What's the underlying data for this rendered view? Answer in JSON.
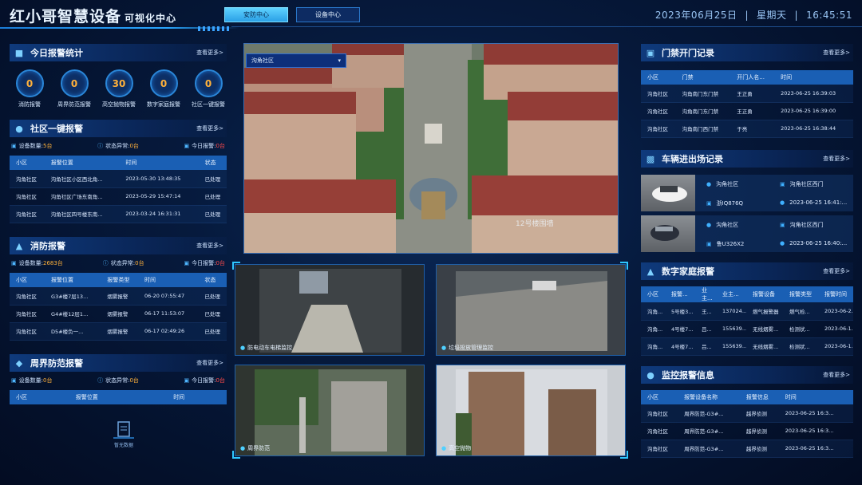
{
  "header": {
    "title": "红小哥智慧设备",
    "subtitle": "可视化中心",
    "tabs": [
      "安防中心",
      "设备中心"
    ],
    "date": "2023年06月25日",
    "weekday": "星期天",
    "time": "16:45:51"
  },
  "more_label": "查看更多>",
  "alarm_stats": {
    "title": "今日报警统计",
    "items": [
      {
        "label": "消防报警",
        "value": "0"
      },
      {
        "label": "周界防范报警",
        "value": "0"
      },
      {
        "label": "高空抛物报警",
        "value": "30"
      },
      {
        "label": "数字家庭报警",
        "value": "0"
      },
      {
        "label": "社区一键报警",
        "value": "0"
      }
    ]
  },
  "community_alarm": {
    "title": "社区一键报警",
    "device_count_label": "设备数量:",
    "device_count": "5台",
    "status_label": "状态异常:",
    "status_abnormal": "0台",
    "today_label": "今日报警:",
    "today_alarm": "0台",
    "columns": [
      "小区",
      "报警位置",
      "时间",
      "状态"
    ],
    "rows": [
      [
        "沟角社区",
        "沟角社区小区西北角...",
        "2023-05-30 13:48:35",
        "已处理"
      ],
      [
        "沟角社区",
        "沟角社区广场东南角...",
        "2023-05-29 15:47:14",
        "已处理"
      ],
      [
        "沟角社区",
        "沟角社区四号楼东南...",
        "2023-03-24 16:31:31",
        "已处理"
      ]
    ]
  },
  "fire_alarm": {
    "title": "消防报警",
    "device_count_label": "设备数量:",
    "device_count": "2683台",
    "status_label": "状态异常:",
    "status_abnormal": "0台",
    "today_label": "今日报警:",
    "today_alarm": "0台",
    "columns": [
      "小区",
      "报警位置",
      "报警类型",
      "时间",
      "状态"
    ],
    "rows": [
      [
        "沟角社区",
        "G3#楼7层13...",
        "烟雾报警",
        "06-20 07:55:47",
        "已处理"
      ],
      [
        "沟角社区",
        "G4#楼12层1...",
        "烟雾报警",
        "06-17 11:53:07",
        "已处理"
      ],
      [
        "沟角社区",
        "D5#楼负一...",
        "烟雾报警",
        "06-17 02:49:26",
        "已处理"
      ]
    ]
  },
  "perimeter_alarm": {
    "title": "周界防范报警",
    "device_count_label": "设备数量:",
    "device_count": "0台",
    "status_label": "状态异常:",
    "status_abnormal": "0台",
    "today_label": "今日报警:",
    "today_alarm": "0台",
    "columns": [
      "小区",
      "报警位置",
      "时间"
    ],
    "no_data": "暂无数据"
  },
  "main_video": {
    "select_value": "沟角社区",
    "overlay_text": "12号楼围墙"
  },
  "cameras": [
    {
      "label": "防电动车电梯监控"
    },
    {
      "label": "垃圾投放管理监控"
    },
    {
      "label": "周界防范"
    },
    {
      "label": "高空抛物"
    }
  ],
  "door_records": {
    "title": "门禁开门记录",
    "columns": [
      "小区",
      "门禁",
      "开门人名...",
      "时间"
    ],
    "rows": [
      [
        "沟角社区",
        "沟角南门东门禁",
        "王正勇",
        "2023-06-25 16:39:03"
      ],
      [
        "沟角社区",
        "沟角南门东门禁",
        "王正勇",
        "2023-06-25 16:39:00"
      ],
      [
        "沟角社区",
        "沟角南门西门禁",
        "于亮",
        "2023-06-25 16:38:44"
      ]
    ]
  },
  "vehicle_records": {
    "title": "车辆进出场记录",
    "items": [
      {
        "community": "沟角社区",
        "gate": "沟角社区西门",
        "plate": "浙IQ876Q",
        "time": "2023-06-25 16:41:..."
      },
      {
        "community": "沟角社区",
        "gate": "沟角社区西门",
        "plate": "鲁U326X2",
        "time": "2023-06-25 16:40:..."
      }
    ]
  },
  "digital_home": {
    "title": "数字家庭报警",
    "columns": [
      "小区",
      "报警...",
      "业主...",
      "业主...",
      "报警设备",
      "报警类型",
      "报警时间"
    ],
    "rows": [
      [
        "沟角...",
        "5号楼3...",
        "王...",
        "137024...",
        "燃气报警器",
        "燃气检...",
        "2023-06-2..."
      ],
      [
        "沟角...",
        "4号楼7...",
        "吕...",
        "155639...",
        "无线烟雾...",
        "检测状...",
        "2023-06-1..."
      ],
      [
        "沟角...",
        "4号楼7...",
        "吕...",
        "155639...",
        "无线烟雾...",
        "检测状...",
        "2023-06-1..."
      ]
    ]
  },
  "monitor_alarm": {
    "title": "监控报警信息",
    "columns": [
      "小区",
      "报警设备名称",
      "报警信息",
      "时间"
    ],
    "rows": [
      [
        "沟角社区",
        "周界防范-G3#...",
        "越界侦测",
        "2023-06-25 16:3..."
      ],
      [
        "沟角社区",
        "周界防范-G3#...",
        "越界侦测",
        "2023-06-25 16:3..."
      ],
      [
        "沟角社区",
        "周界防范-G3#...",
        "越界侦测",
        "2023-06-25 16:3..."
      ]
    ]
  },
  "colors": {
    "accent": "#2aa7ff",
    "alarm_value": "#ffb13b",
    "alert": "#ff4a4a",
    "header_row": "#1a5fb4"
  }
}
